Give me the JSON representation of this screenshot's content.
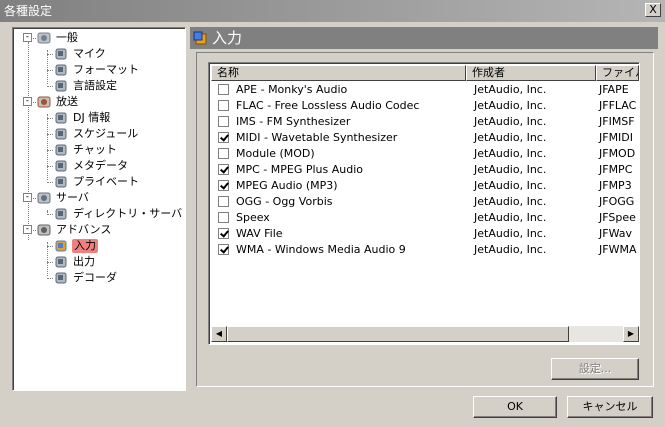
{
  "window": {
    "title": "各種設定",
    "close_label": "X"
  },
  "tree": {
    "groups": [
      {
        "label": "一般",
        "expander": "-",
        "children": [
          "マイク",
          "フォーマット",
          "言語設定"
        ]
      },
      {
        "label": "放送",
        "expander": "-",
        "children": [
          "DJ 情報",
          "スケジュール",
          "チャット",
          "メタデータ",
          "プライベート"
        ]
      },
      {
        "label": "サーバ",
        "expander": "-",
        "children": [
          "ディレクトリ・サーバ"
        ]
      },
      {
        "label": "アドバンス",
        "expander": "-",
        "children": [
          "入力",
          "出力",
          "デコーダ"
        ]
      }
    ],
    "selected": "入力"
  },
  "panel": {
    "title": "入力"
  },
  "list": {
    "columns": [
      "名称",
      "作成者",
      "ファイル"
    ],
    "rows": [
      {
        "checked": false,
        "name": "APE - Monky's Audio",
        "author": "JetAudio, Inc.",
        "file": "JFAPE"
      },
      {
        "checked": false,
        "name": "FLAC - Free Lossless Audio Codec",
        "author": "JetAudio, Inc.",
        "file": "JFFLAC"
      },
      {
        "checked": false,
        "name": "IMS - FM Synthesizer",
        "author": "JetAudio, Inc.",
        "file": "JFIMSF"
      },
      {
        "checked": true,
        "name": "MIDI - Wavetable Synthesizer",
        "author": "JetAudio, Inc.",
        "file": "JFMIDI"
      },
      {
        "checked": false,
        "name": "Module (MOD)",
        "author": "JetAudio, Inc.",
        "file": "JFMOD"
      },
      {
        "checked": true,
        "name": "MPC - MPEG Plus Audio",
        "author": "JetAudio, Inc.",
        "file": "JFMPC"
      },
      {
        "checked": true,
        "name": "MPEG Audio (MP3)",
        "author": "JetAudio, Inc.",
        "file": "JFMP3"
      },
      {
        "checked": false,
        "name": "OGG - Ogg Vorbis",
        "author": "JetAudio, Inc.",
        "file": "JFOGG"
      },
      {
        "checked": false,
        "name": "Speex",
        "author": "JetAudio, Inc.",
        "file": "JFSpee"
      },
      {
        "checked": true,
        "name": "WAV File",
        "author": "JetAudio, Inc.",
        "file": "JFWav"
      },
      {
        "checked": true,
        "name": "WMA - Windows Media Audio 9",
        "author": "JetAudio, Inc.",
        "file": "JFWMA"
      }
    ]
  },
  "buttons": {
    "settings": "設定...",
    "ok": "OK",
    "cancel": "キャンセル"
  },
  "colors": {
    "titlebar": "#808080",
    "selection": "#f08080",
    "face": "#d4d0c8"
  }
}
